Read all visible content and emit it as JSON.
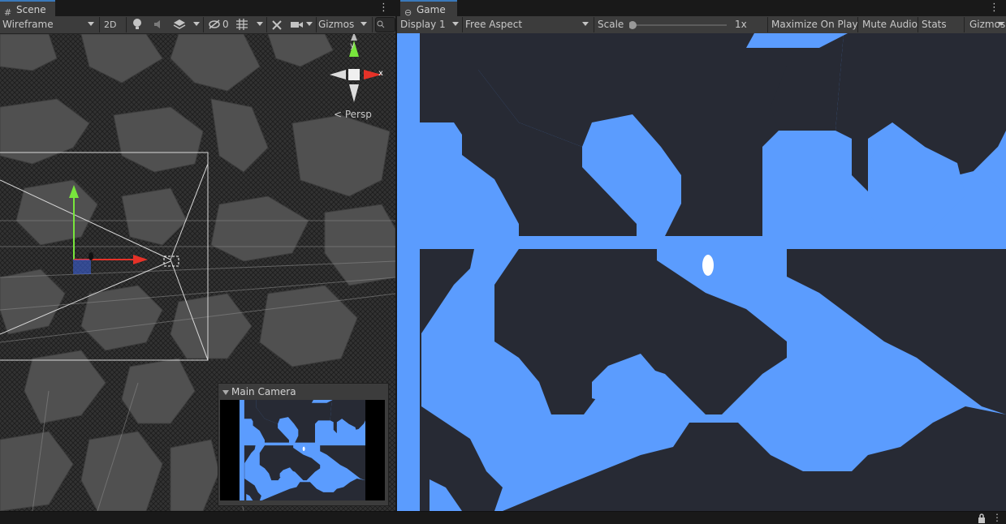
{
  "scene": {
    "tab_label": "Scene",
    "render_mode": "Wireframe",
    "btn_2d": "2D",
    "hidden_count": "0",
    "gizmos_label": "Gizmos",
    "persp_label": "< Persp",
    "axis_y": "y",
    "axis_x": "x",
    "camera_preview": {
      "title": "Main Camera"
    }
  },
  "game": {
    "tab_label": "Game",
    "display": "Display 1",
    "aspect": "Free Aspect",
    "scale_label": "Scale",
    "scale_value": "1x",
    "scale_level": 0,
    "maximize_label": "Maximize On Play",
    "mute_label": "Mute Audio",
    "stats_label": "Stats",
    "gizmos_label": "Gizmos"
  },
  "colors": {
    "water": "#5b9cfe",
    "land": "#272a34",
    "player": "#ffffff",
    "scene_land": "#505050",
    "scene_wall": "#282828",
    "axis_x": "#e63228",
    "axis_y": "#78e63c",
    "axis_z": "#3c64e6"
  },
  "icons": {
    "scene_tab": "hash-grid-icon",
    "game_tab": "gamepad-icon",
    "lighting": "lightbulb-icon",
    "audio": "speaker-icon",
    "effects": "layers-icon",
    "visibility": "eye-slash-icon",
    "grid": "grid-icon",
    "tools": "wrench-icon",
    "camera": "camera-icon",
    "search": "search-icon",
    "lock": "lock-icon",
    "more": "kebab-icon"
  }
}
